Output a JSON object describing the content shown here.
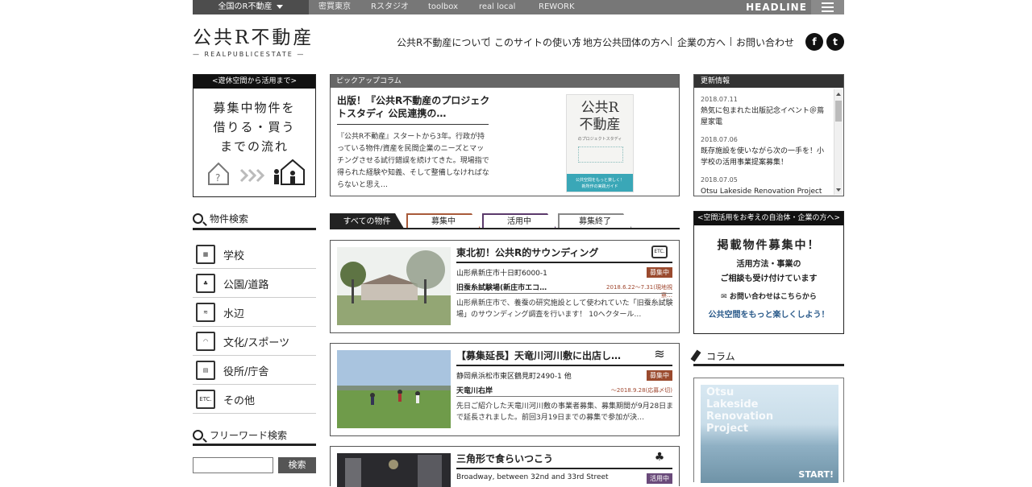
{
  "topbar": {
    "region": "全国のR不動産",
    "nav": [
      "密買東京",
      "Rスタジオ",
      "toolbox",
      "real local",
      "REWORK"
    ],
    "headline": "HEADLINE"
  },
  "logo": {
    "jp": "公共R不動産",
    "en": "— REALPUBLICESTATE —"
  },
  "gnav": [
    "公共R不動産について",
    "このサイトの使い方",
    "地方公共団体の方へ",
    "企業の方へ",
    "お問い合わせ"
  ],
  "social": {
    "facebook": "f",
    "twitter": "t"
  },
  "left_banner": {
    "head": "<遊休空間から活用まで>",
    "lines": [
      "募集中物件を",
      "借りる・買う",
      "までの流れ"
    ]
  },
  "search": {
    "title": "物件検索",
    "categories": [
      {
        "label": "学校",
        "icon": "school-icon",
        "glyph": "▦"
      },
      {
        "label": "公園/道路",
        "icon": "park-icon",
        "glyph": "♣"
      },
      {
        "label": "水辺",
        "icon": "waterside-icon",
        "glyph": "≋"
      },
      {
        "label": "文化/スポーツ",
        "icon": "culture-icon",
        "glyph": "◠"
      },
      {
        "label": "役所/庁舎",
        "icon": "office-icon",
        "glyph": "▤"
      },
      {
        "label": "その他",
        "icon": "etc-icon",
        "glyph": "ETC."
      }
    ],
    "freeword_title": "フリーワード検索",
    "freeword_button": "検索",
    "freeword_value": ""
  },
  "pickup": {
    "head": "ピックアップコラム",
    "title": "出版！『公共R不動産のプロジェクトスタディ 公民連携の…",
    "text": "『公共R不動産』スタートから3年。行政が持っている物件/資産を民間企業のニーズとマッチングさせる試行錯誤を続けてきた。現場指で得られた経験や知義、そして整備しなければならないと思え…",
    "book_title": "公共R\n不動産",
    "book_sub": "のプロジェクトスタディ",
    "book_band": "公共空間をもっと楽しく！\n新所作の実践ガイド"
  },
  "tabs": [
    "すべての物件",
    "募集中",
    "活用中",
    "募集終了"
  ],
  "tab_colors": [
    "#222222",
    "#a85a3a",
    "#5b3a6b",
    "#888888"
  ],
  "cards": [
    {
      "title": "東北初！公共R的サウンディング",
      "icon": "ETC.",
      "address": "山形県新庄市十日町6000-1",
      "badge": "募集中",
      "badge_color": "#9a4a2e",
      "sub": "旧蚕糸試験場(新庄市エコ…",
      "date": "2018.6.22〜7.31(現地視察…",
      "desc": "山形県新庄市で、養蚕の研究施設として使われていた「旧蚕糸試験場」のサウンディング調査を行います！ 10ヘクタール…"
    },
    {
      "title": "【募集延長】天竜川河川敷に出店し…",
      "icon": "≋",
      "address": "静岡県浜松市東区鶴見町2490-1 他",
      "badge": "募集中",
      "badge_color": "#9a4a2e",
      "sub": "天竜川右岸",
      "date": "〜2018.9.28(応募〆切)",
      "desc": "先日ご紹介した天竜川河川敷の事業者募集、募集期間が9月28日まで延長されました。前回3月19日までの募集で参加が決…"
    },
    {
      "title": "三角形で食らいつこう",
      "icon": "♣",
      "address": "Broadway, between 32nd and 33rd Street",
      "badge": "活用中",
      "badge_color": "#6a4a7a",
      "sub": "",
      "date": "",
      "desc": ""
    }
  ],
  "updates": {
    "head": "更新情報",
    "items": [
      {
        "date": "2018.07.11",
        "text": "熱気に包まれた出版記念イベント＠蔦屋家電"
      },
      {
        "date": "2018.07.06",
        "text": "既存施設を使いながら次の一手を！小学校の活用事業提案募集！"
      },
      {
        "date": "2018.07.05",
        "text": "Otsu Lakeside Renovation Project"
      }
    ]
  },
  "right_banner": {
    "head": "<空間活用をお考えの自治体・企業の方へ>",
    "big": "掲載物件募集中！",
    "mid": "活用方法・事業の\nご相談も受け付けています",
    "cta": "✉ お問い合わせはこちらから",
    "foot": "公共空間をもっと楽しくしよう！"
  },
  "column": {
    "title": "コラム",
    "image_text": "Otsu\nLakeside\nRenovation\nProject",
    "start": "START!"
  }
}
